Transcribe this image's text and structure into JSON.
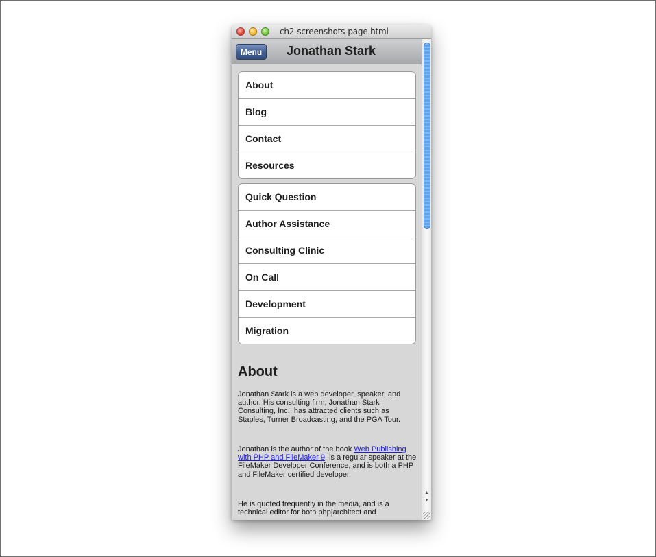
{
  "window": {
    "title": "ch2-screenshots-page.html"
  },
  "header": {
    "menu_label": "Menu",
    "title": "Jonathan Stark"
  },
  "nav_groups": [
    {
      "items": [
        "About",
        "Blog",
        "Contact",
        "Resources"
      ]
    },
    {
      "items": [
        "Quick Question",
        "Author Assistance",
        "Consulting Clinic",
        "On Call",
        "Development",
        "Migration"
      ]
    }
  ],
  "about": {
    "heading": "About",
    "p1": "Jonathan Stark is a web developer, speaker, and author. His consulting firm, Jonathan Stark Consulting, Inc., has attracted clients such as Staples, Turner Broadcasting, and the PGA Tour.",
    "p2_before": "Jonathan is the author of the book ",
    "p2_link": "Web Publishing with PHP and FileMaker 9",
    "p2_after": ", is a regular speaker at the FileMaker Developer Conference, and is both a PHP and FileMaker certified developer.",
    "p3": "He is quoted frequently in the media, and is a technical editor for both php|architect and"
  },
  "colors": {
    "menu_button": "#3f5c92",
    "link": "#1a1aee",
    "scroll_thumb": "#5ea3ec"
  },
  "icons": {
    "close": "close-icon",
    "minimize": "minimize-icon",
    "zoom": "zoom-icon",
    "scroll_up": "arrow-up-icon",
    "scroll_down": "arrow-down-icon"
  }
}
